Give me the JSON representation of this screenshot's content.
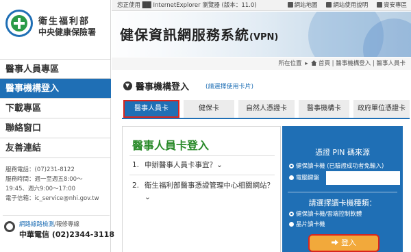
{
  "topbar": {
    "notice": "您正使用 ██ InternetExplorer 瀏覽器 (版本：11.0)",
    "links": [
      "網站地圖",
      "網站使用說明",
      "資安專區"
    ]
  },
  "logo": {
    "line1": "衛生福利部",
    "line2": "中央健康保險署"
  },
  "banner": {
    "title": "健保資訊網服務系統",
    "suffix": "(VPN)"
  },
  "breadcrumb": {
    "prefix": "所在位置",
    "path": "首頁 | 醫事機構登入 | 醫事人員卡"
  },
  "nav": [
    {
      "label": "醫事人員專區",
      "active": false
    },
    {
      "label": "醫事機構登入",
      "active": true
    },
    {
      "label": "下載專區",
      "active": false
    },
    {
      "label": "聯絡窗口",
      "active": false
    },
    {
      "label": "友善連結",
      "active": false
    }
  ],
  "contact": {
    "phone": "服務電話：(07)231-8122",
    "hours1": "服務時間：週一至週五8:00～",
    "hours2": "19:45、週六9:00～17:00",
    "email": "電子信箱：ic_service@nhi.gov.tw"
  },
  "isp": {
    "line1_a": "網路線路檢測",
    "line1_b": "/報修專線",
    "line2": "中華電信 (02)2344-3118"
  },
  "section": {
    "title": "醫事機構登入",
    "hint": "(請選擇使用卡片)"
  },
  "tabs": [
    "醫事人員卡",
    "健保卡",
    "自然人憑證卡",
    "醫事機構卡",
    "政府單位憑證卡"
  ],
  "card": {
    "title": "醫事人員卡登入",
    "faq": [
      {
        "num": "1.",
        "text": "申辦醫事人員卡事宜？⌄"
      },
      {
        "num": "2.",
        "text": "衛生福利部醫事憑證管理中心相關網站？⌄"
      }
    ]
  },
  "pin": {
    "source_title": "憑證 PIN 碼來源",
    "source_opt1": "健保讀卡機 (已驗證成功者免輸入)",
    "source_opt2": "電腦鍵盤",
    "reader_title": "請選擇讀卡機種類：",
    "reader_opt1": "健保讀卡機/雲端控制軟體",
    "reader_opt2": "晶片讀卡機",
    "login": "登入"
  }
}
